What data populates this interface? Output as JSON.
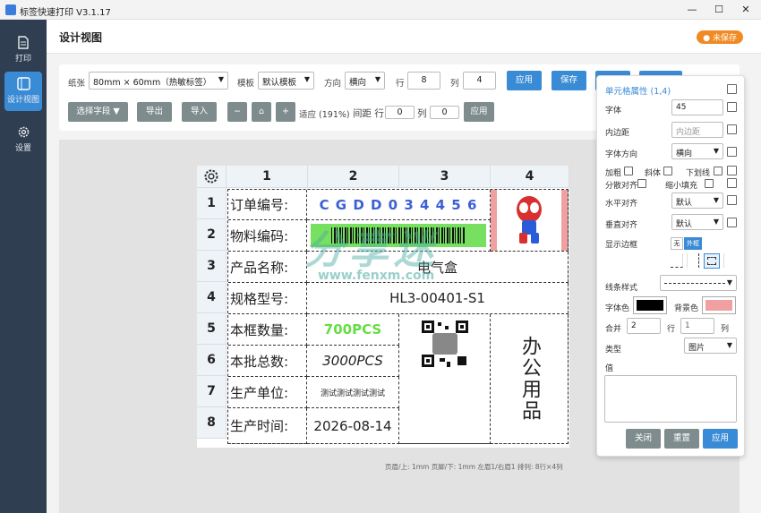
{
  "app": {
    "title": "标签快速打印 V3.1.17"
  },
  "window": {
    "minimize": "—",
    "maximize": "☐",
    "close": "✕"
  },
  "sidebar": {
    "items": [
      {
        "label": "打印",
        "icon": "document-icon"
      },
      {
        "label": "设计视图",
        "icon": "design-icon"
      },
      {
        "label": "设置",
        "icon": "gear-icon"
      }
    ]
  },
  "header": {
    "title": "设计视图",
    "unsaved": "● 未保存"
  },
  "toolbar": {
    "paper_label": "纸张",
    "paper_value": "80mm × 60mm（热敏标签）",
    "template_label": "模板",
    "template_value": "默认模板",
    "direction_label": "方向",
    "direction_value": "横向",
    "rows_label": "行",
    "rows_value": "8",
    "cols_label": "列",
    "cols_value": "4",
    "apply": "应用",
    "save": "保存",
    "select_field": "选择字段 ▼",
    "export": "导出",
    "import": "导入",
    "zoom_out": "−",
    "zoom_home": "⌂",
    "zoom_in": "+",
    "fit": "适应 (191%)",
    "spacing_label": "间距 行",
    "spacing_row": "0",
    "spacing_col_label": "列",
    "spacing_col": "0",
    "apply2": "应用"
  },
  "label": {
    "col_headers": [
      "1",
      "2",
      "3",
      "4"
    ],
    "row_headers": [
      "1",
      "2",
      "3",
      "4",
      "5",
      "6",
      "7",
      "8"
    ],
    "labels": [
      "订单编号:",
      "物料编码:",
      "产品名称:",
      "规格型号:",
      "本框数量:",
      "本批总数:",
      "生产单位:",
      "生产时间:"
    ],
    "order_no": "C G D D 0 3 4 4 5 6",
    "product_name": "电气盒",
    "spec": "HL3-00401-S1",
    "qty": "700PCS",
    "total": "3000PCS",
    "unit": "测试测试测试测试",
    "date": "2026-08-14",
    "office": "办公用品",
    "watermark": "分享迷",
    "watermark_url": "www.fenxm.com"
  },
  "status": "页眉/上: 1mm 页脚/下: 1mm 左眉1/右眉1 排列: 8行×4列",
  "props": {
    "title": "单元格属性 (1,4)",
    "font_label": "字体",
    "font_value": "45",
    "padding_label": "内边距",
    "padding_placeholder": "内边距",
    "font_dir_label": "字体方向",
    "font_dir_value": "横向",
    "bold": "加粗",
    "italic": "斜体",
    "underline": "下划线",
    "distribute": "分散对齐",
    "shrink": "缩小填充",
    "halign_label": "水平对齐",
    "halign_value": "默认",
    "valign_label": "垂直对齐",
    "valign_value": "默认",
    "border_label": "显示边框",
    "border_none": "无",
    "border_outer": "外框",
    "line_style_label": "线条样式",
    "font_color_label": "字体色",
    "bg_color_label": "背景色",
    "merge_label": "合并",
    "merge_rows": "2",
    "merge_rows_label": "行",
    "merge_cols": "1",
    "merge_cols_label": "列",
    "type_label": "类型",
    "type_value": "图片",
    "value_label": "值",
    "close": "关闭",
    "reset": "重置",
    "apply": "应用"
  },
  "colors": {
    "accent": "#3a8bd6",
    "sidebar": "#2f3e50",
    "unsaved": "#f08a24",
    "font_color": "#000000",
    "bg_color": "#f0a0a0",
    "green": "#66dd44",
    "barcode_bg": "#77e060"
  }
}
